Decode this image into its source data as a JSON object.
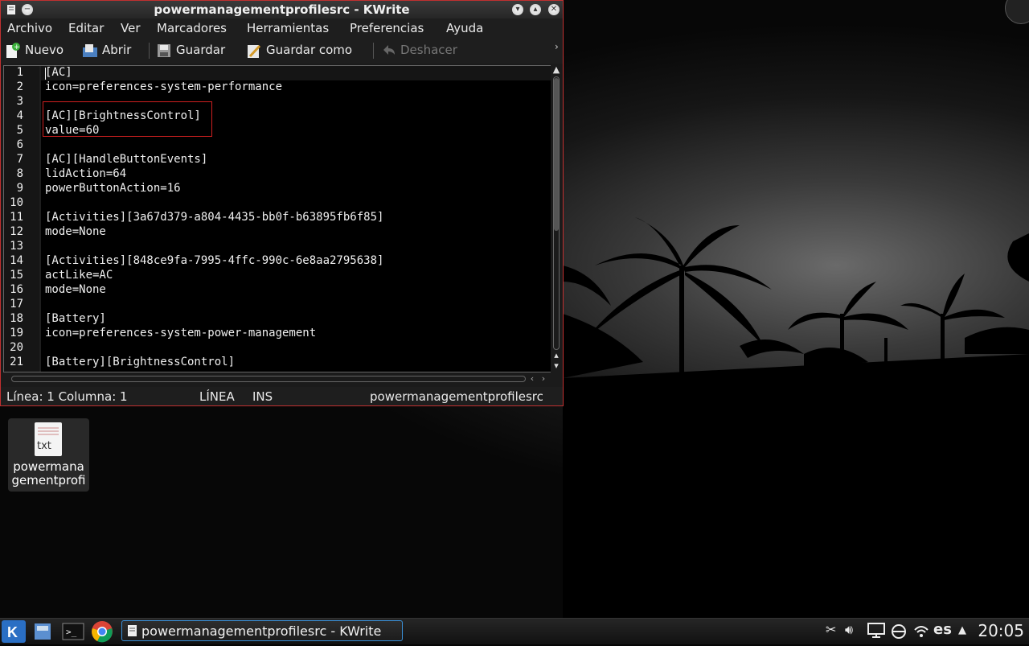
{
  "window": {
    "title": "powermanagementprofilesrc - KWrite"
  },
  "menu": {
    "items": [
      "Archivo",
      "Editar",
      "Ver",
      "Marcadores",
      "Herramientas",
      "Preferencias",
      "Ayuda"
    ]
  },
  "toolbar": {
    "new_label": "Nuevo",
    "open_label": "Abrir",
    "save_label": "Guardar",
    "save_as_label": "Guardar como",
    "undo_label": "Deshacer",
    "overflow": "›"
  },
  "editor": {
    "line_numbers": [
      "1",
      "2",
      "3",
      "4",
      "5",
      "6",
      "7",
      "8",
      "9",
      "10",
      "11",
      "12",
      "13",
      "14",
      "15",
      "16",
      "17",
      "18",
      "19",
      "20",
      "21"
    ],
    "lines": [
      "[AC]",
      "icon=preferences-system-performance",
      "",
      "[AC][BrightnessControl]",
      "value=60",
      "",
      "[AC][HandleButtonEvents]",
      "lidAction=64",
      "powerButtonAction=16",
      "",
      "[Activities][3a67d379-a804-4435-bb0f-b63895fb6f85]",
      "mode=None",
      "",
      "[Activities][848ce9fa-7995-4ffc-990c-6e8aa2795638]",
      "actLike=AC",
      "mode=None",
      "",
      "[Battery]",
      "icon=preferences-system-power-management",
      "",
      "[Battery][BrightnessControl]"
    ]
  },
  "statusbar": {
    "position": "Línea: 1 Columna: 1",
    "mode": "LÍNEA",
    "insert": "INS",
    "filename": "powermanagementprofilesrc"
  },
  "desktop": {
    "icon_ext": "txt",
    "icon_label": "powermanagementprofilesrc"
  },
  "taskbar": {
    "task_label": "powermanagementprofilesrc - KWrite",
    "language": "es",
    "clock": "20:05"
  },
  "colors": {
    "window_border": "#c03030",
    "highlight_box": "#d02020",
    "task_active_border": "#3a8fd6"
  }
}
